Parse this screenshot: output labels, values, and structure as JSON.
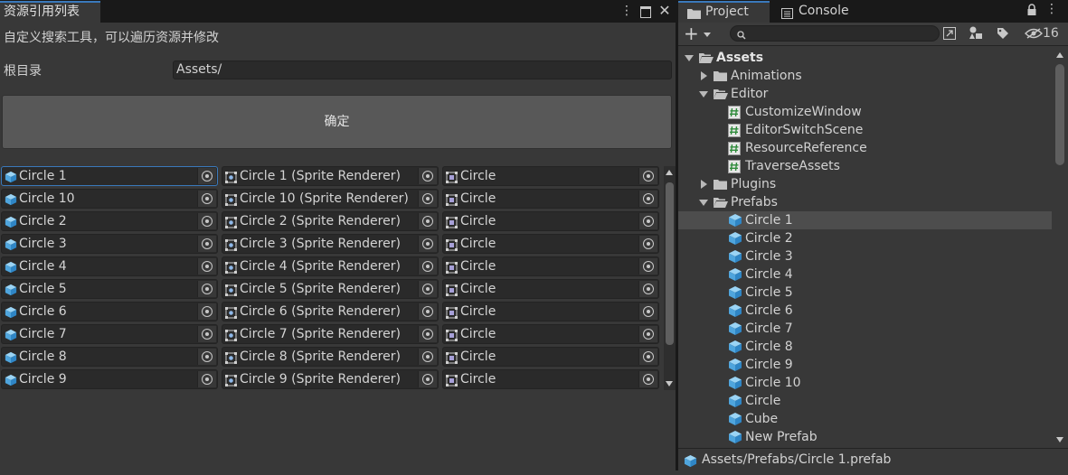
{
  "left_window": {
    "tab_title": "资源引用列表",
    "description": "自定义搜索工具，可以遍历资源并修改",
    "root_label": "根目录",
    "root_value": "Assets/",
    "confirm_label": "确定",
    "rows": [
      {
        "prefab": "Circle 1",
        "renderer": "Circle 1 (Sprite Renderer)",
        "sprite": "Circle"
      },
      {
        "prefab": "Circle 10",
        "renderer": "Circle 10 (Sprite Renderer)",
        "sprite": "Circle"
      },
      {
        "prefab": "Circle 2",
        "renderer": "Circle 2 (Sprite Renderer)",
        "sprite": "Circle"
      },
      {
        "prefab": "Circle 3",
        "renderer": "Circle 3 (Sprite Renderer)",
        "sprite": "Circle"
      },
      {
        "prefab": "Circle 4",
        "renderer": "Circle 4 (Sprite Renderer)",
        "sprite": "Circle"
      },
      {
        "prefab": "Circle 5",
        "renderer": "Circle 5 (Sprite Renderer)",
        "sprite": "Circle"
      },
      {
        "prefab": "Circle 6",
        "renderer": "Circle 6 (Sprite Renderer)",
        "sprite": "Circle"
      },
      {
        "prefab": "Circle 7",
        "renderer": "Circle 7 (Sprite Renderer)",
        "sprite": "Circle"
      },
      {
        "prefab": "Circle 8",
        "renderer": "Circle 8 (Sprite Renderer)",
        "sprite": "Circle"
      },
      {
        "prefab": "Circle 9",
        "renderer": "Circle 9 (Sprite Renderer)",
        "sprite": "Circle"
      }
    ]
  },
  "right_window": {
    "tabs": {
      "project": "Project",
      "console": "Console"
    },
    "hidden_count": "16",
    "tree": [
      {
        "label": "Assets",
        "depth": 0,
        "type": "folder-open",
        "arrow": "down",
        "bold": true
      },
      {
        "label": "Animations",
        "depth": 1,
        "type": "folder",
        "arrow": "right"
      },
      {
        "label": "Editor",
        "depth": 1,
        "type": "folder-open",
        "arrow": "down"
      },
      {
        "label": "CustomizeWindow",
        "depth": 2,
        "type": "script"
      },
      {
        "label": "EditorSwitchScene",
        "depth": 2,
        "type": "script"
      },
      {
        "label": "ResourceReference",
        "depth": 2,
        "type": "script"
      },
      {
        "label": "TraverseAssets",
        "depth": 2,
        "type": "script"
      },
      {
        "label": "Plugins",
        "depth": 1,
        "type": "folder",
        "arrow": "right"
      },
      {
        "label": "Prefabs",
        "depth": 1,
        "type": "folder-open",
        "arrow": "down"
      },
      {
        "label": "Circle 1",
        "depth": 2,
        "type": "prefab",
        "selected": true
      },
      {
        "label": "Circle 2",
        "depth": 2,
        "type": "prefab"
      },
      {
        "label": "Circle 3",
        "depth": 2,
        "type": "prefab"
      },
      {
        "label": "Circle 4",
        "depth": 2,
        "type": "prefab"
      },
      {
        "label": "Circle 5",
        "depth": 2,
        "type": "prefab"
      },
      {
        "label": "Circle 6",
        "depth": 2,
        "type": "prefab"
      },
      {
        "label": "Circle 7",
        "depth": 2,
        "type": "prefab"
      },
      {
        "label": "Circle 8",
        "depth": 2,
        "type": "prefab"
      },
      {
        "label": "Circle 9",
        "depth": 2,
        "type": "prefab"
      },
      {
        "label": "Circle 10",
        "depth": 2,
        "type": "prefab"
      },
      {
        "label": "Circle",
        "depth": 2,
        "type": "prefab"
      },
      {
        "label": "Cube",
        "depth": 2,
        "type": "prefab"
      },
      {
        "label": "New Prefab",
        "depth": 2,
        "type": "prefab"
      }
    ],
    "status_path": "Assets/Prefabs/Circle 1.prefab"
  },
  "colors": {
    "accent": "#3a79bb",
    "prefab_blue": "#5fb3e8",
    "background": "#383838",
    "field_bg": "#2a2a2a"
  }
}
